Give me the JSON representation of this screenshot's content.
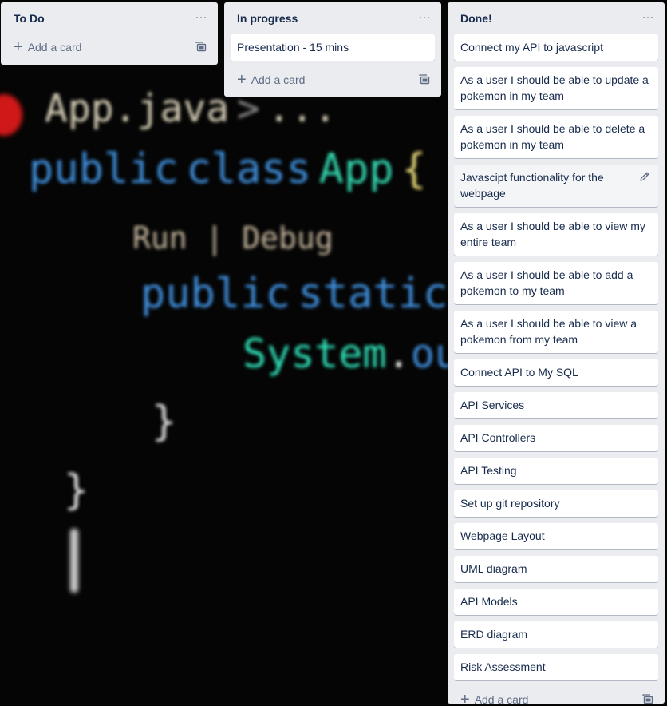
{
  "background": {
    "file_name": "App.java",
    "breadcrumb_sep": ">",
    "ellipsis": "...",
    "kw_public": "public",
    "kw_class": "class",
    "class_name": "App",
    "open_brace": "{",
    "code_lens": "Run | Debug",
    "kw_public2": "public",
    "kw_static": "static",
    "sys": "System",
    "dot": ".",
    "out": "ou",
    "close_brace_inner": "}",
    "close_brace_outer": "}"
  },
  "lists": [
    {
      "title": "To Do",
      "menu": "…",
      "cards": [],
      "add_label": "Add a card"
    },
    {
      "title": "In progress",
      "menu": "…",
      "cards": [
        {
          "text": "Presentation - 15 mins"
        }
      ],
      "add_label": "Add a card"
    },
    {
      "title": "Done!",
      "menu": "…",
      "cards": [
        {
          "text": "Connect my API to javascript"
        },
        {
          "text": "As a user I should be able to update a pokemon in my team"
        },
        {
          "text": "As a user I should be able to delete a pokemon in my team"
        },
        {
          "text": "Javascipt functionality for the webpage"
        },
        {
          "text": "As a user I should be able to view my entire team"
        },
        {
          "text": "As a user I should be able to add a pokemon to my team"
        },
        {
          "text": "As a user I should be able to view a pokemon from my team"
        },
        {
          "text": "Connect API to My SQL"
        },
        {
          "text": "API Services"
        },
        {
          "text": "API Controllers"
        },
        {
          "text": "API Testing"
        },
        {
          "text": "Set up git repository"
        },
        {
          "text": "Webpage Layout"
        },
        {
          "text": "UML diagram"
        },
        {
          "text": "API Models"
        },
        {
          "text": "ERD diagram"
        },
        {
          "text": "Risk Assessment"
        }
      ],
      "add_label": "Add a card"
    }
  ],
  "icons": {
    "menu": "ellipsis-icon",
    "add": "plus-icon",
    "template": "card-template-icon",
    "edit": "pencil-icon"
  },
  "colors": {
    "list_bg": "#ebecf0",
    "card_bg": "#ffffff",
    "text": "#172b4d",
    "muted": "#5e6c84"
  }
}
